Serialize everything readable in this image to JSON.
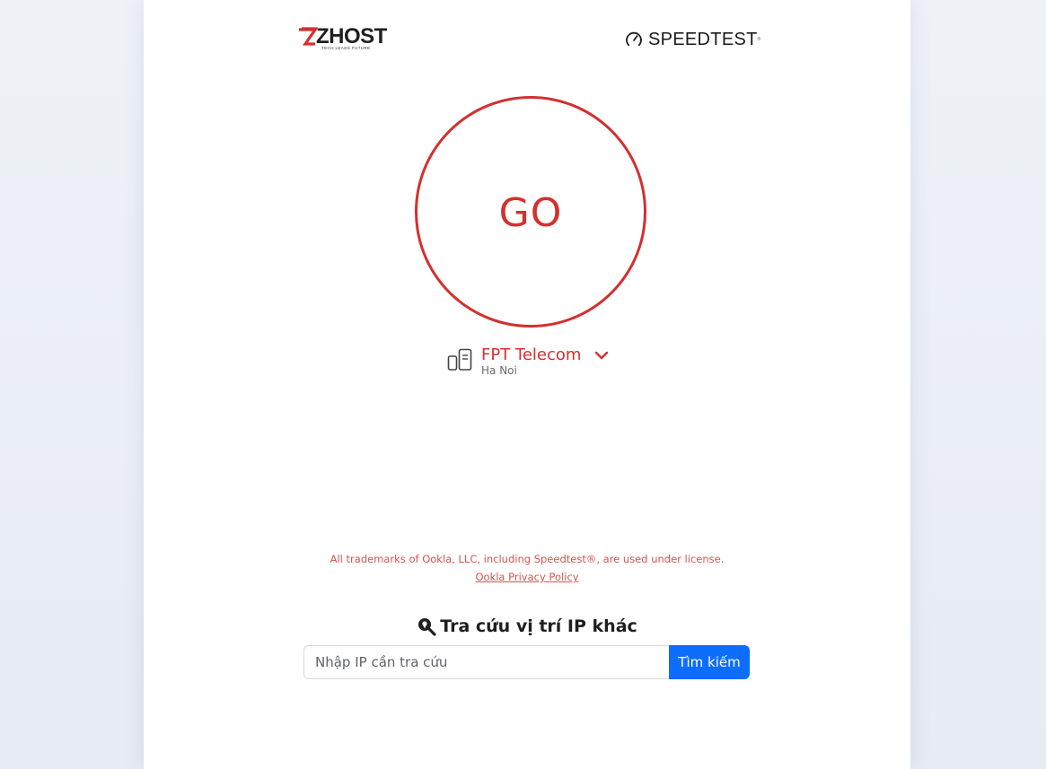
{
  "header": {
    "brand_logo": {
      "name": "ZHOST",
      "tagline": "TECH LEADS FUTURE",
      "icon": "zhost-z-icon"
    },
    "partner_logo": {
      "name": "SPEEDTEST",
      "trademark_mark": "®",
      "icon": "speedometer-icon"
    }
  },
  "speedtest": {
    "go_label": "GO",
    "server": {
      "name": "FPT Telecom",
      "location": "Ha Noi",
      "icon": "server-icon",
      "expand_icon": "chevron-down-icon"
    }
  },
  "legal": {
    "trademark_text": "All trademarks of Ookla, LLC, including Speedtest®, are used under license.",
    "privacy_link": "Ookla Privacy Policy"
  },
  "ip_lookup": {
    "title": "Tra cứu vị trí IP khác",
    "title_icon": "magnifier-pin-icon",
    "input_placeholder": "Nhập IP cần tra cứu",
    "input_value": "",
    "search_button": "Tìm kiếm"
  },
  "colors": {
    "accent_red": "#d3302f",
    "button_blue": "#0d6efd",
    "page_background": "#e9eef4",
    "card_background": "#ffffff"
  }
}
